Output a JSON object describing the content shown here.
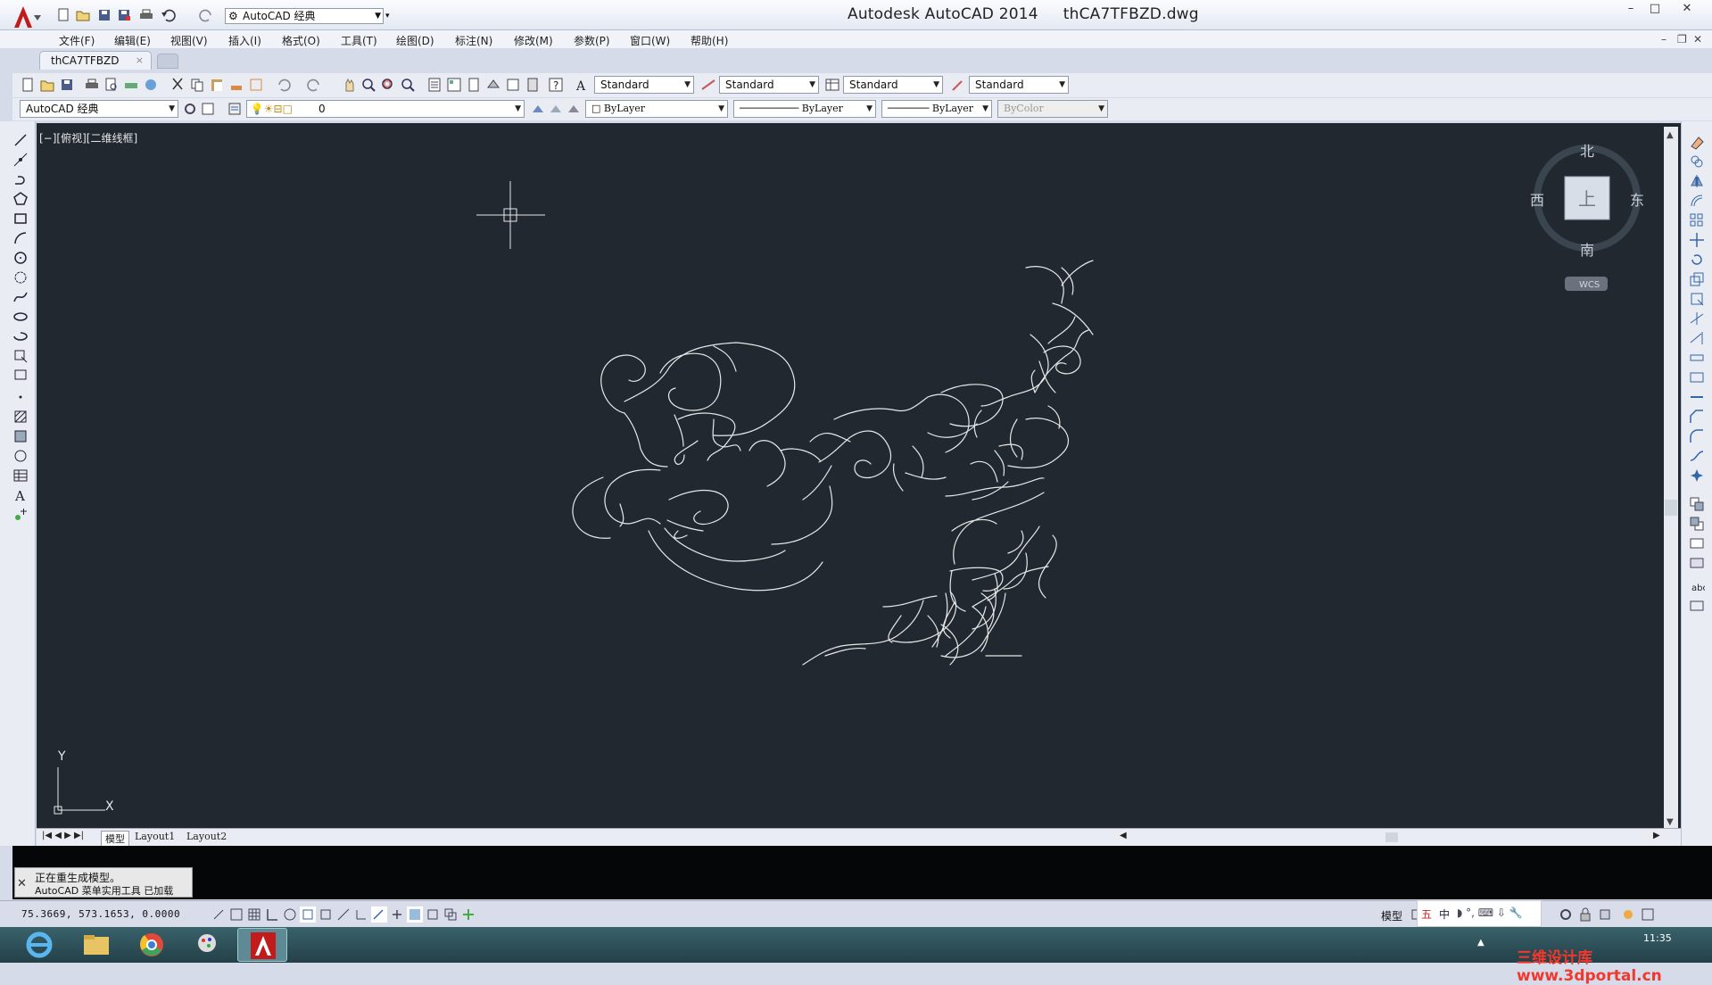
{
  "window": {
    "title": "Autodesk AutoCAD 2014     thCA7TFBZD.dwg",
    "workspace": "AutoCAD 经典",
    "controls": {
      "minimize": "–",
      "maximize": "□",
      "close": "✕"
    }
  },
  "menu": [
    "文件(F)",
    "编辑(E)",
    "视图(V)",
    "插入(I)",
    "格式(O)",
    "工具(T)",
    "绘图(D)",
    "标注(N)",
    "修改(M)",
    "参数(P)",
    "窗口(W)",
    "帮助(H)"
  ],
  "file_tab": {
    "label": "thCA7TFBZD",
    "close": "×"
  },
  "styles": {
    "text_style": "Standard",
    "dim_style": "Standard",
    "table_style": "Standard",
    "multileader_style": "Standard"
  },
  "properties": {
    "workspace": "AutoCAD 经典",
    "layer": "0",
    "color": "ByLayer",
    "linetype": "ByLayer",
    "lineweight": "ByLayer",
    "plotstyle": "ByColor"
  },
  "viewport": {
    "label": "[−][俯视][二维线框]"
  },
  "viewcube": {
    "north": "北",
    "south": "南",
    "east": "东",
    "west": "西",
    "top": "上",
    "wcs": "WCS"
  },
  "ucs": {
    "x": "X",
    "y": "Y"
  },
  "layout_tabs": [
    "模型",
    "Layout1",
    "Layout2"
  ],
  "command": {
    "line1": "正在重生成模型。",
    "line2": "AutoCAD 菜单实用工具 已加载"
  },
  "status": {
    "coords": "75.3669,  573.1653,  0.0000",
    "model": "模型"
  },
  "taskbar": {
    "time": "11:35",
    "ime": [
      "五",
      "中"
    ],
    "watermark": "三维设计库 www.3dportal.cn"
  },
  "colors": {
    "canvas": "#212830",
    "drawing": "#e8e8e8",
    "titlebar": "#eef1f7"
  }
}
